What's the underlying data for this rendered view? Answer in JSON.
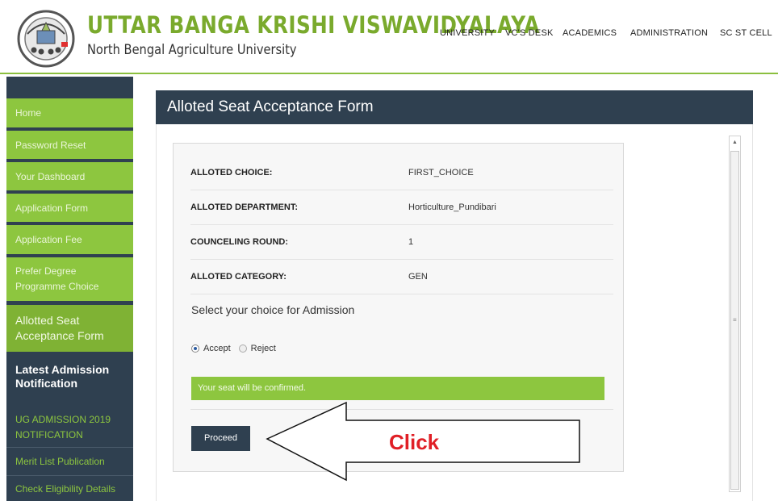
{
  "header": {
    "title": "UTTAR BANGA KRISHI VISWAVIDYALAYA",
    "subtitle": "North Bengal Agriculture University",
    "brand_color": "#7aaa2d",
    "nav": [
      "UNIVERSITY",
      "VC'S DESK",
      "ACADEMICS",
      "ADMINISTRATION",
      "SC ST CELL"
    ]
  },
  "sidebar": {
    "items": [
      {
        "label": "Home"
      },
      {
        "label": "Password Reset"
      },
      {
        "label": "Your Dashboard"
      },
      {
        "label": "Application Form"
      },
      {
        "label": "Application Fee"
      },
      {
        "label": "Prefer Degree Programme Choice"
      },
      {
        "label": "Allotted Seat Acceptance Form"
      }
    ],
    "heading": "Latest Admission Notification",
    "links": [
      {
        "label": "UG ADMISSION 2019 NOTIFICATION"
      },
      {
        "label": "Merit List Publication"
      },
      {
        "label": "Check Eligibility Details"
      }
    ]
  },
  "panel": {
    "title": "Alloted Seat Acceptance Form",
    "rows": [
      {
        "label": "ALLOTED CHOICE:",
        "value": "FIRST_CHOICE"
      },
      {
        "label": "ALLOTED DEPARTMENT:",
        "value": "Horticulture_Pundibari"
      },
      {
        "label": "COUNCELING ROUND:",
        "value": "1"
      },
      {
        "label": "ALLOTED CATEGORY:",
        "value": "GEN"
      }
    ],
    "choice_prompt": "Select your choice for Admission",
    "radio_accept": "Accept",
    "radio_reject": "Reject",
    "selected": "Accept",
    "confirmation": "Your seat will be confirmed.",
    "proceed_label": "Proceed"
  },
  "annotation": {
    "label": "Click",
    "color": "#e01f26"
  },
  "colors": {
    "green": "#8dc63f",
    "navy": "#2f4050"
  }
}
